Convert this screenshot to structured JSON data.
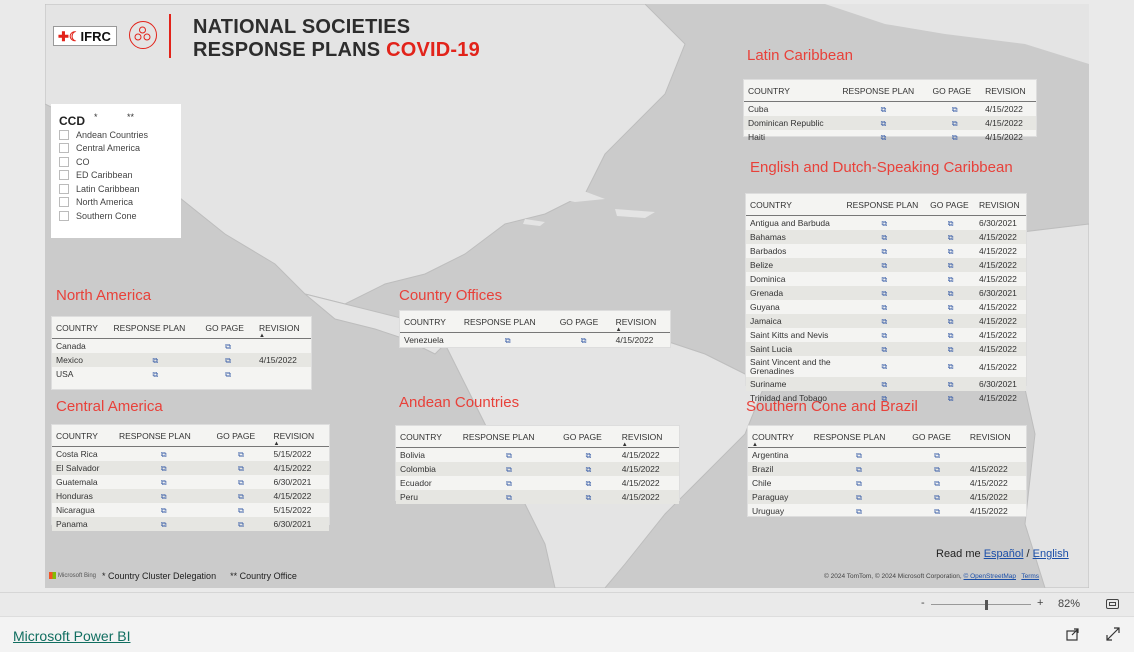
{
  "header": {
    "logo_text": "IFRC",
    "title_line1": "NATIONAL SOCIETIES",
    "title_line2": "RESPONSE PLANS",
    "title_accent": "COVID-19"
  },
  "filter": {
    "label": "CCD",
    "star1": "*",
    "star2": "**",
    "options": [
      "Andean Countries",
      "Central America",
      "CO",
      "ED Caribbean",
      "Latin Caribbean",
      "North America",
      "Southern Cone"
    ]
  },
  "columns": {
    "country": "COUNTRY",
    "response_plan": "RESPONSE PLAN",
    "go_page": "GO PAGE",
    "revision": "REVISION"
  },
  "link_icon": "⧉",
  "regions": {
    "north_america": {
      "title": "North America",
      "rows": [
        {
          "country": "Canada",
          "rp": false,
          "go": true,
          "rev": ""
        },
        {
          "country": "Mexico",
          "rp": true,
          "go": true,
          "rev": "4/15/2022"
        },
        {
          "country": "USA",
          "rp": true,
          "go": true,
          "rev": ""
        }
      ]
    },
    "central_america": {
      "title": "Central America",
      "rows": [
        {
          "country": "Costa Rica",
          "rp": true,
          "go": true,
          "rev": "5/15/2022"
        },
        {
          "country": "El Salvador",
          "rp": true,
          "go": true,
          "rev": "4/15/2022"
        },
        {
          "country": "Guatemala",
          "rp": true,
          "go": true,
          "rev": "6/30/2021"
        },
        {
          "country": "Honduras",
          "rp": true,
          "go": true,
          "rev": "4/15/2022"
        },
        {
          "country": "Nicaragua",
          "rp": true,
          "go": true,
          "rev": "5/15/2022"
        },
        {
          "country": "Panama",
          "rp": true,
          "go": true,
          "rev": "6/30/2021"
        }
      ]
    },
    "country_offices": {
      "title": "Country Offices",
      "rows": [
        {
          "country": "Venezuela",
          "rp": true,
          "go": true,
          "rev": "4/15/2022"
        }
      ]
    },
    "andean": {
      "title": "Andean Countries",
      "rows": [
        {
          "country": "Bolivia",
          "rp": true,
          "go": true,
          "rev": "4/15/2022"
        },
        {
          "country": "Colombia",
          "rp": true,
          "go": true,
          "rev": "4/15/2022"
        },
        {
          "country": "Ecuador",
          "rp": true,
          "go": true,
          "rev": "4/15/2022"
        },
        {
          "country": "Peru",
          "rp": true,
          "go": true,
          "rev": "4/15/2022"
        }
      ]
    },
    "latin_caribbean": {
      "title": "Latin Caribbean",
      "rows": [
        {
          "country": "Cuba",
          "rp": true,
          "go": true,
          "rev": "4/15/2022"
        },
        {
          "country": "Dominican Republic",
          "rp": true,
          "go": true,
          "rev": "4/15/2022"
        },
        {
          "country": "Haiti",
          "rp": true,
          "go": true,
          "rev": "4/15/2022"
        }
      ]
    },
    "ed_caribbean": {
      "title": "English and Dutch-Speaking Caribbean",
      "rows": [
        {
          "country": "Antigua and Barbuda",
          "rp": true,
          "go": true,
          "rev": "6/30/2021"
        },
        {
          "country": "Bahamas",
          "rp": true,
          "go": true,
          "rev": "4/15/2022"
        },
        {
          "country": "Barbados",
          "rp": true,
          "go": true,
          "rev": "4/15/2022"
        },
        {
          "country": "Belize",
          "rp": true,
          "go": true,
          "rev": "4/15/2022"
        },
        {
          "country": "Dominica",
          "rp": true,
          "go": true,
          "rev": "4/15/2022"
        },
        {
          "country": "Grenada",
          "rp": true,
          "go": true,
          "rev": "6/30/2021"
        },
        {
          "country": "Guyana",
          "rp": true,
          "go": true,
          "rev": "4/15/2022"
        },
        {
          "country": "Jamaica",
          "rp": true,
          "go": true,
          "rev": "4/15/2022"
        },
        {
          "country": "Saint Kitts and Nevis",
          "rp": true,
          "go": true,
          "rev": "4/15/2022"
        },
        {
          "country": "Saint Lucia",
          "rp": true,
          "go": true,
          "rev": "4/15/2022"
        },
        {
          "country": "Saint Vincent and the Grenadines",
          "rp": true,
          "go": true,
          "rev": "4/15/2022"
        },
        {
          "country": "Suriname",
          "rp": true,
          "go": true,
          "rev": "6/30/2021"
        },
        {
          "country": "Trinidad and Tobago",
          "rp": true,
          "go": true,
          "rev": "4/15/2022"
        }
      ]
    },
    "southern_cone": {
      "title": "Southern Cone and Brazil",
      "rows": [
        {
          "country": "Argentina",
          "rp": true,
          "go": true,
          "rev": ""
        },
        {
          "country": "Brazil",
          "rp": true,
          "go": true,
          "rev": "4/15/2022"
        },
        {
          "country": "Chile",
          "rp": true,
          "go": true,
          "rev": "4/15/2022"
        },
        {
          "country": "Paraguay",
          "rp": true,
          "go": true,
          "rev": "4/15/2022"
        },
        {
          "country": "Uruguay",
          "rp": true,
          "go": true,
          "rev": "4/15/2022"
        }
      ]
    }
  },
  "footnotes": {
    "bing": "Microsoft Bing",
    "ccd_note": "* Country Cluster Delegation",
    "co_note": "** Country Office"
  },
  "readme": {
    "prefix": "Read me",
    "es": "Español",
    "sep": "/",
    "en": "English"
  },
  "credits": {
    "text": "© 2024 TomTom, © 2024 Microsoft Corporation,",
    "osm": "© OpenStreetMap",
    "terms": "Terms"
  },
  "zoom": {
    "minus": "-",
    "plus": "+",
    "percent": "82%",
    "level": 0.55
  },
  "footer": {
    "powerbi": "Microsoft Power BI"
  },
  "colors": {
    "accent": "#e8413a",
    "link": "#3b5fa8",
    "powerbi_link": "#106e60"
  }
}
